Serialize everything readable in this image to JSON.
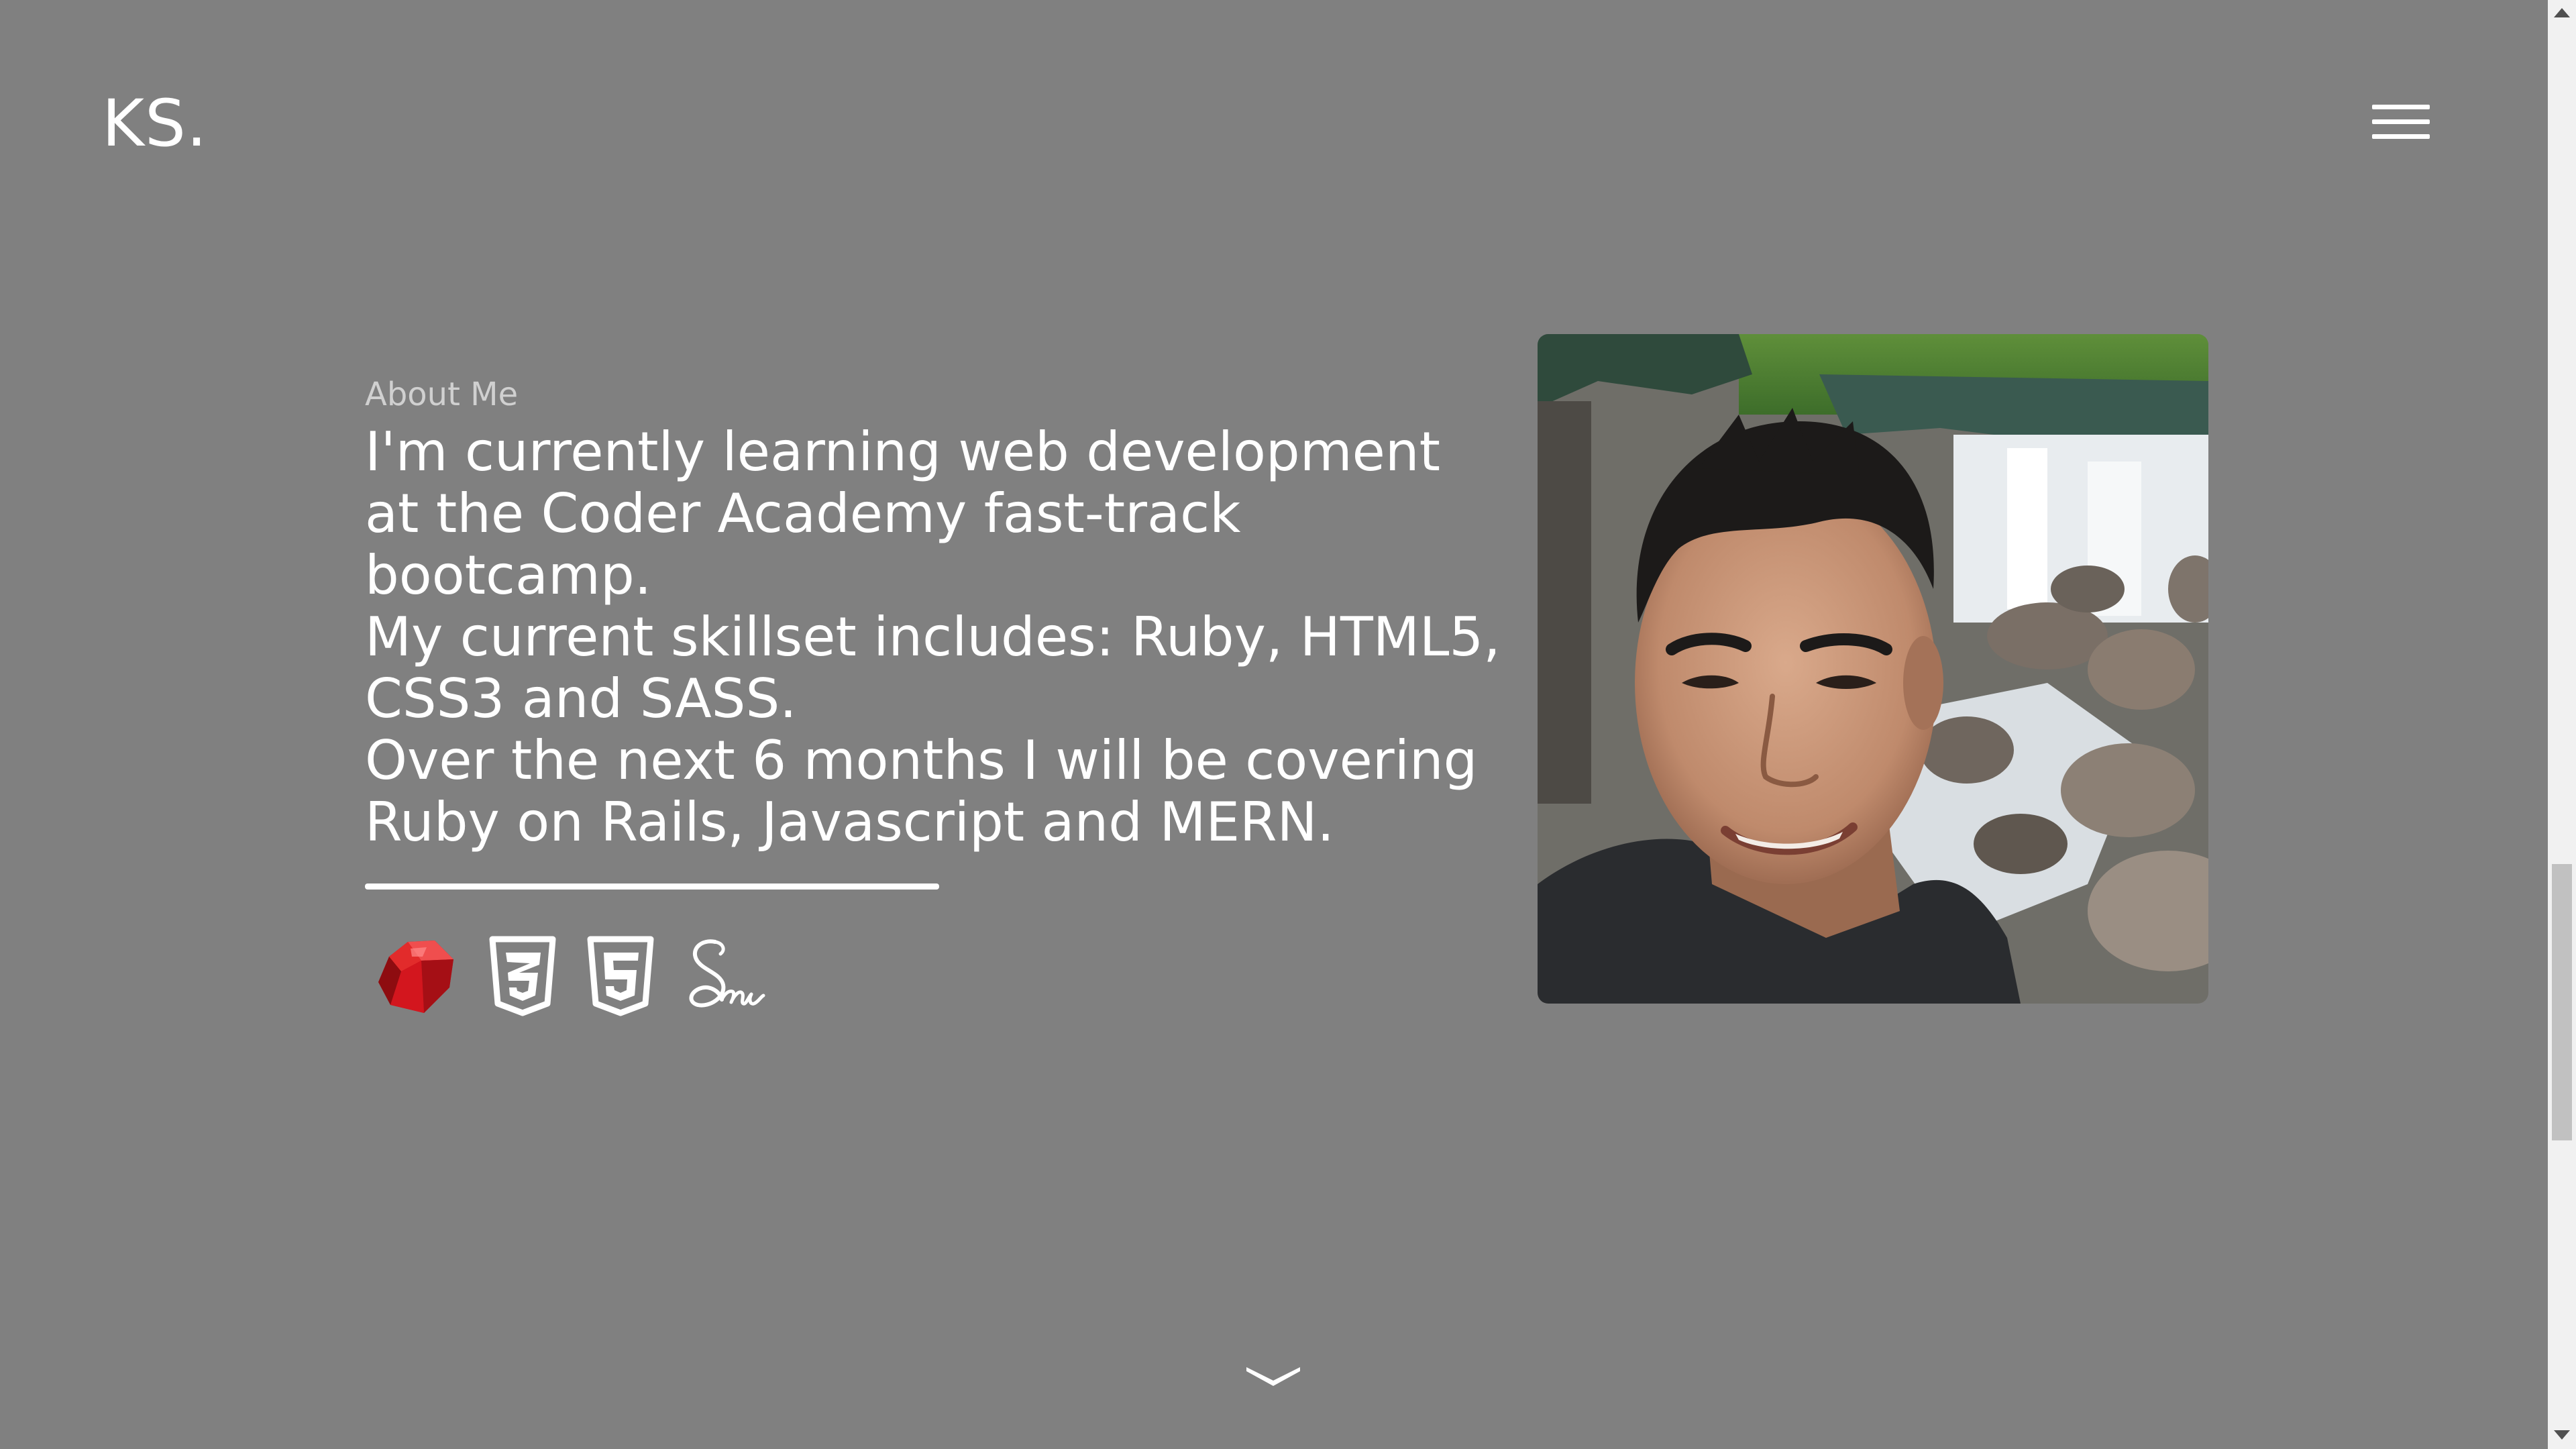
{
  "header": {
    "logo_text": "KS.",
    "menu_icon": "hamburger-menu-icon"
  },
  "about": {
    "label": "About Me",
    "paragraphs": [
      "I'm currently learning web development at the Coder Academy fast-track bootcamp.",
      "My current skillset includes: Ruby, HTML5, CSS3 and SASS.",
      "Over the next 6 months I will be covering Ruby on Rails, Javascript and MERN."
    ],
    "skills": [
      {
        "icon": "ruby-icon",
        "color": "#d3161e"
      },
      {
        "icon": "css3-icon",
        "color": "#ffffff"
      },
      {
        "icon": "html5-icon",
        "color": "#ffffff"
      },
      {
        "icon": "sass-icon",
        "color": "#ffffff"
      }
    ]
  },
  "photo": {
    "icon": "profile-photo"
  },
  "footer": {
    "scroll_icon": "chevron-down-icon"
  },
  "colors": {
    "background": "#808080",
    "text": "#ffffff",
    "label": "#d0d0d0"
  }
}
